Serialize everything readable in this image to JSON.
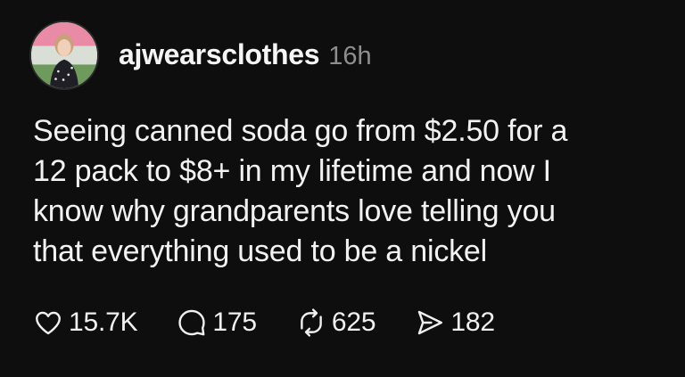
{
  "post": {
    "username": "ajwearsclothes",
    "timestamp": "16h",
    "text_lines": [
      "Seeing canned soda go from $2.50 for a",
      "12 pack to $8+ in my lifetime and now I",
      "know why grandparents love telling you",
      "that everything used to be a nickel"
    ]
  },
  "actions": {
    "like": {
      "icon": "heart-icon",
      "count": "15.7K"
    },
    "reply": {
      "icon": "comment-icon",
      "count": "175"
    },
    "repost": {
      "icon": "repost-icon",
      "count": "625"
    },
    "share": {
      "icon": "send-icon",
      "count": "182"
    }
  },
  "colors": {
    "background": "#0e0e0e",
    "text": "#f2f2f2",
    "muted": "#8e8e8e"
  }
}
